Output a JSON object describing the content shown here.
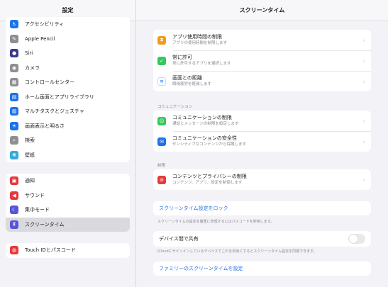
{
  "sidebar": {
    "title": "設定",
    "group1": [
      {
        "label": "アクセシビリティ",
        "icon": "accessibility-icon",
        "color": "#1a73e8",
        "glyph": "♿"
      },
      {
        "label": "Apple Pencil",
        "icon": "pencil-icon",
        "color": "#8e8e93",
        "glyph": "✎"
      },
      {
        "label": "Siri",
        "icon": "siri-icon",
        "color": "#3a3a8c",
        "glyph": "●"
      },
      {
        "label": "カメラ",
        "icon": "camera-icon",
        "color": "#8e8e93",
        "glyph": "◉"
      },
      {
        "label": "コントロールセンター",
        "icon": "control-center-icon",
        "color": "#8e8e93",
        "glyph": "▦"
      },
      {
        "label": "ホーム画面とアプリライブラリ",
        "icon": "home-screen-icon",
        "color": "#1a73e8",
        "glyph": "▤"
      },
      {
        "label": "マルチタスクとジェスチャ",
        "icon": "multitasking-icon",
        "color": "#1a73e8",
        "glyph": "▥"
      },
      {
        "label": "画面表示と明るさ",
        "icon": "brightness-icon",
        "color": "#1a73e8",
        "glyph": "☀"
      },
      {
        "label": "検索",
        "icon": "search-icon",
        "color": "#8e8e93",
        "glyph": "⌕"
      },
      {
        "label": "壁紙",
        "icon": "wallpaper-icon",
        "color": "#34aadc",
        "glyph": "❋"
      }
    ],
    "group2": [
      {
        "label": "通知",
        "icon": "notifications-icon",
        "color": "#e5393b",
        "glyph": "▣"
      },
      {
        "label": "サウンド",
        "icon": "sound-icon",
        "color": "#e5393b",
        "glyph": "◀"
      },
      {
        "label": "集中モード",
        "icon": "focus-icon",
        "color": "#5856d6",
        "glyph": "☾"
      },
      {
        "label": "スクリーンタイム",
        "icon": "screen-time-icon",
        "color": "#5856d6",
        "glyph": "⧗"
      }
    ],
    "group3": [
      {
        "label": "Touch IDとパスコード",
        "icon": "touch-id-icon",
        "color": "#e5393b",
        "glyph": "◍"
      }
    ]
  },
  "main": {
    "title": "スクリーンタイム",
    "top_rows": [
      {
        "title": "アプリ使用時間の制限",
        "sub": "アプリの使用時間を制限します",
        "icon": "hourglass-icon",
        "color": "#f19a1b",
        "glyph": "⧗"
      },
      {
        "title": "常に許可",
        "sub": "常に許可するアプリを選択します",
        "icon": "checkmark-icon",
        "color": "#34c759",
        "glyph": "✓"
      },
      {
        "title": "画面との距離",
        "sub": "眼精疲労を軽減します",
        "icon": "distance-icon",
        "color": "#ffffff",
        "glyph": "≋"
      }
    ],
    "communication_label": "コミュニケーション",
    "communication_rows": [
      {
        "title": "コミュニケーションの制限",
        "sub": "通話とメッセージの制限を設定します",
        "icon": "contacts-icon",
        "color": "#34c759",
        "glyph": "☺"
      },
      {
        "title": "コミュニケーションの安全性",
        "sub": "センシティブなコンテンツから保護します",
        "icon": "chat-icon",
        "color": "#1a73e8",
        "glyph": "✉"
      }
    ],
    "restrictions_label": "制限",
    "restrictions_rows": [
      {
        "title": "コンテンツとプライバシーの制限",
        "sub": "コンテンツ、アプリ、設定を制御します",
        "icon": "restricted-icon",
        "color": "#e5393b",
        "glyph": "⊘"
      }
    ],
    "lock_link": "スクリーンタイム設定をロック",
    "lock_note": "スクリーンタイムの設定を厳重に管理するにはパスコードを使用します。",
    "share_label": "デバイス間で共有",
    "share_toggle": "off",
    "share_note": "iCloudにサインインしているデバイスでこれを有効にするとスクリーンタイム設定を同期できます。",
    "family_link": "ファミリーのスクリーンタイムを設定"
  }
}
